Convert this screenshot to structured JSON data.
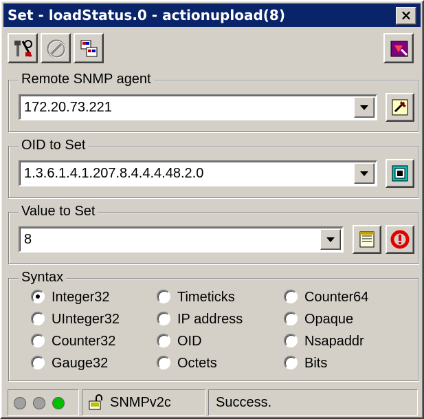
{
  "window": {
    "title": "Set - loadStatus.0 - actionupload(8)",
    "close_label": "×"
  },
  "toolbar": {
    "buttons": [
      {
        "icon": "tools-icon"
      },
      {
        "icon": "disabled-circle-icon"
      },
      {
        "icon": "mib-browser-icon"
      },
      {
        "icon": "exit-icon"
      }
    ]
  },
  "agent": {
    "label": "Remote SNMP agent",
    "value": "172.20.73.221"
  },
  "oid": {
    "label": "OID to Set",
    "value": "1.3.6.1.4.1.207.8.4.4.4.48.2.0"
  },
  "value_to_set": {
    "label": "Value to Set",
    "value": "8"
  },
  "syntax": {
    "label": "Syntax",
    "selected": "Integer32",
    "options": [
      "Integer32",
      "Timeticks",
      "Counter64",
      "UInteger32",
      "IP address",
      "Opaque",
      "Counter32",
      "OID",
      "Nsapaddr",
      "Gauge32",
      "Octets",
      "Bits"
    ]
  },
  "status": {
    "version": "SNMPv2c",
    "message": "Success.",
    "leds": [
      "#a0a0a0",
      "#a0a0a0",
      "#00c000"
    ]
  },
  "colors": {
    "title_bar": "#0a246a",
    "face": "#d4d0c8"
  }
}
